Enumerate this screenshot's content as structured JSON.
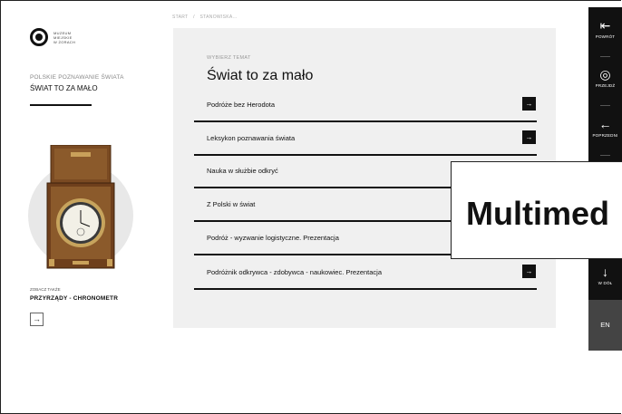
{
  "logo": {
    "lines": [
      "MUZEUM",
      "MIEJSKIE",
      "W ŻORACH"
    ]
  },
  "section": {
    "label": "POLSKIE POZNAWANIE ŚWIATA",
    "title": "ŚWIAT TO ZA MAŁO"
  },
  "see_also": {
    "label": "ZOBACZ TAKŻE",
    "title": "PRZYRZĄDY - CHRONOMETR",
    "arrow": "→"
  },
  "breadcrumb": [
    "START",
    "/",
    "STANOWISKA..."
  ],
  "panel": {
    "label": "WYBIERZ TEMAT",
    "title": "Świat to za mało",
    "topics": [
      {
        "label": "Podróże bez Herodota",
        "arrow": "→"
      },
      {
        "label": "Leksykon poznawania świata",
        "arrow": "→"
      },
      {
        "label": "Nauka w służbie odkryć",
        "arrow": ""
      },
      {
        "label": "Z Polski w świat",
        "arrow": ""
      },
      {
        "label": "Podróż - wyzwanie logistyczne. Prezentacja",
        "arrow": ""
      },
      {
        "label": "Podróżnik odkrywca - zdobywca - naukowiec. Prezentacja",
        "arrow": "→"
      }
    ]
  },
  "overlay": {
    "text": "Multimed"
  },
  "right_nav": {
    "items": [
      {
        "icon": "⇤",
        "icon_name": "exit-icon",
        "label": "POWRÓT"
      },
      {
        "icon": "◎",
        "icon_name": "compass-icon",
        "label": "PRZEJDŹ"
      },
      {
        "icon": "←",
        "icon_name": "arrow-left-icon",
        "label": "POPRZEDNI"
      }
    ],
    "down": {
      "icon": "↓",
      "icon_name": "arrow-down-icon",
      "label": "W DÓŁ"
    },
    "lang": "EN"
  },
  "colors": {
    "nav_bg": "#111111",
    "panel_bg": "#f0f0f0",
    "lang_bg": "#444444",
    "accent": "#111111"
  }
}
